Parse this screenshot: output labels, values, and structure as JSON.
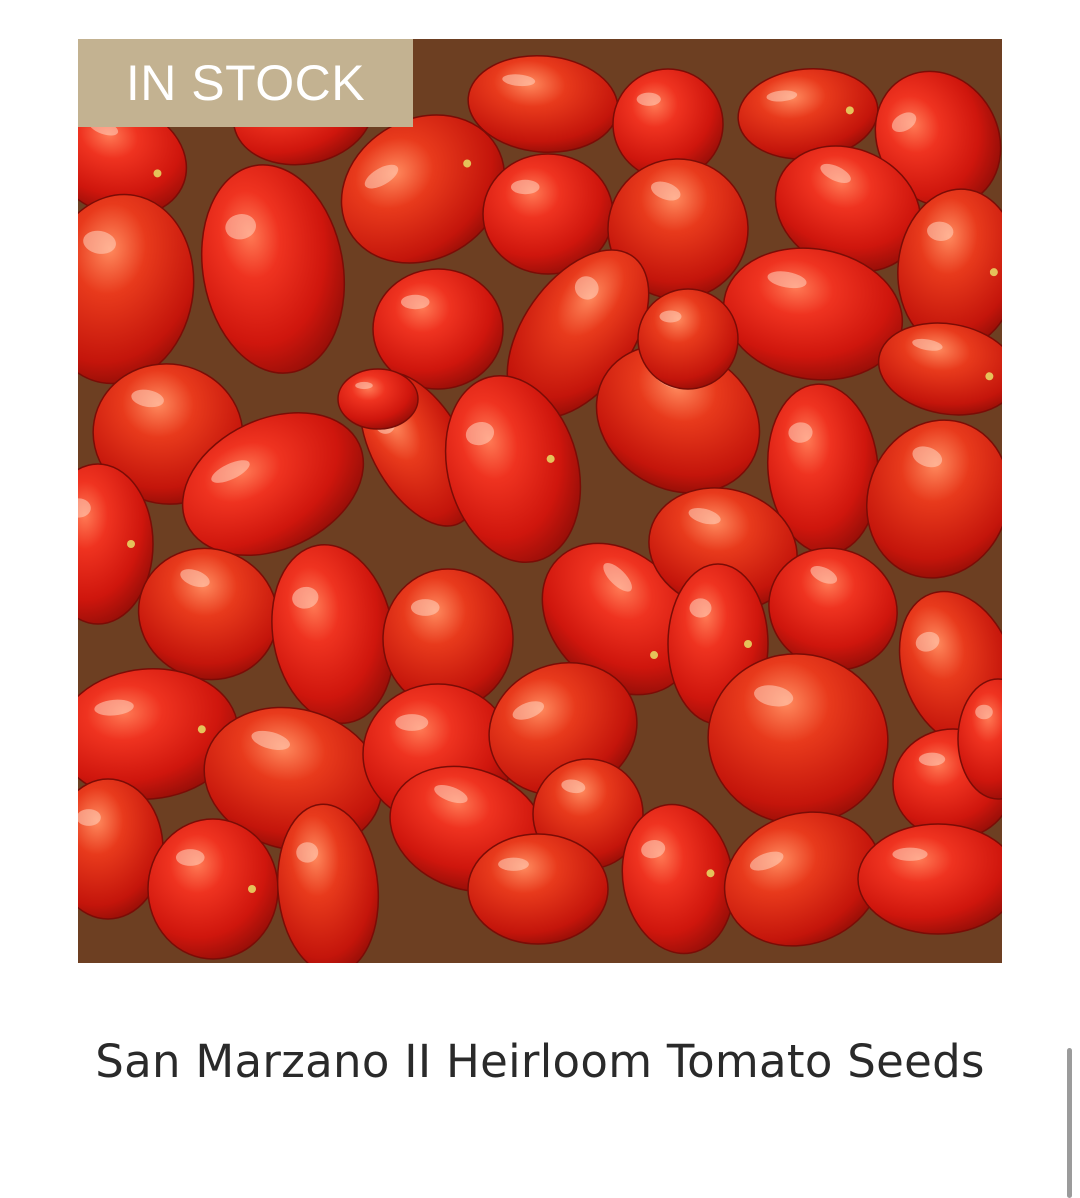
{
  "product": {
    "badge_label": "IN STOCK",
    "title": "San Marzano II Heirloom Tomato Seeds",
    "image_subject": "tomatoes-photo"
  },
  "colors": {
    "badge_background": "#c3b291",
    "badge_text": "#ffffff",
    "title_text": "#2a2a2a",
    "tomato_red": "#d91f14",
    "box_brown": "#7a4a2c"
  }
}
